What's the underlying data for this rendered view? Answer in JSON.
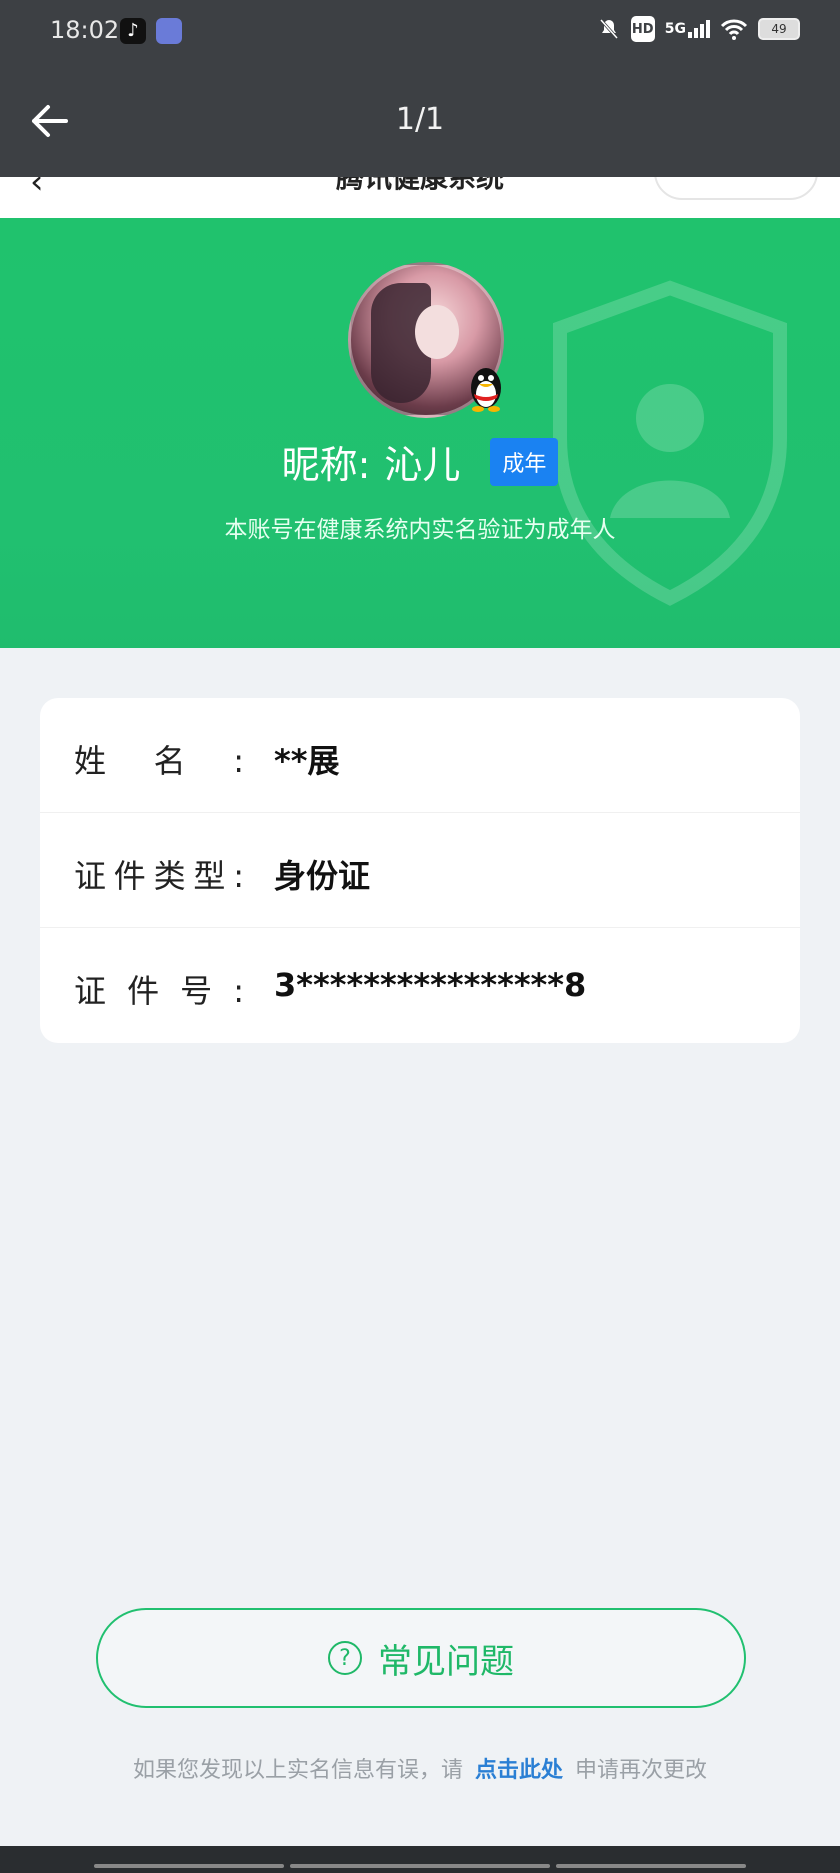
{
  "status_bar": {
    "time": "18:02",
    "icons": [
      "tiktok-icon",
      "app-icon",
      "mute-icon",
      "hd-icon",
      "5g-signal-icon",
      "wifi-icon",
      "battery-icon"
    ],
    "hd": "HD",
    "network": "5G",
    "battery": "49"
  },
  "viewer": {
    "page_counter": "1/1"
  },
  "app_header": {
    "title": "腾讯健康系统"
  },
  "profile": {
    "nickname_label": "昵称:",
    "nickname": "沁儿",
    "age_badge": "成年",
    "verify_text": "本账号在健康系统内实名验证为成年人"
  },
  "info_rows": [
    {
      "label": "姓名:",
      "value": "**展"
    },
    {
      "label": "证件类型:",
      "value": "身份证"
    },
    {
      "label": "证件号:",
      "value": "3****************8"
    }
  ],
  "faq_button": {
    "label": "常见问题",
    "icon": "?"
  },
  "hint": {
    "prefix": "如果您发现以上实名信息有误，请",
    "link": "点击此处",
    "suffix": "申请再次更改"
  },
  "colors": {
    "primary_green": "#21c070",
    "badge_blue": "#1a82f2",
    "link_blue": "#2a7fd4"
  }
}
